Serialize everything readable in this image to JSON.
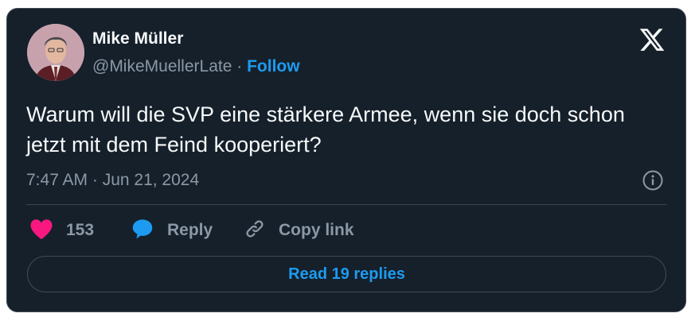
{
  "tweet": {
    "author_name": "Mike Müller",
    "handle": "@MikeMuellerLate",
    "separator": "·",
    "follow_label": "Follow",
    "text": "Warum will die SVP eine stärkere Armee, wenn sie doch schon jetzt mit dem Feind kooperiert?",
    "timestamp": "7:47 AM · Jun 21, 2024"
  },
  "actions": {
    "like_count": "153",
    "reply_label": "Reply",
    "copy_link_label": "Copy link"
  },
  "read_replies_label": "Read 19 replies",
  "icons": {
    "brand": "x-logo-icon",
    "info": "info-icon",
    "like": "heart-icon",
    "reply": "speech-bubble-icon",
    "copy": "link-icon"
  },
  "colors": {
    "background": "#15202b",
    "accent": "#1d9bf0",
    "like": "#f91880",
    "muted": "#8b98a5",
    "text": "#f7f9f9"
  }
}
